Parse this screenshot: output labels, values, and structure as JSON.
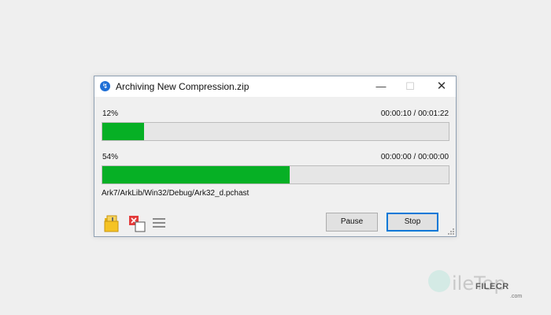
{
  "window": {
    "title": "Archiving New Compression.zip",
    "app_icon": "archive-app-icon",
    "controls": {
      "minimize": "—",
      "maximize": "☐",
      "close": "✕"
    }
  },
  "progress": [
    {
      "percent_label": "12%",
      "percent": 12,
      "time": "00:00:10 / 00:01:22"
    },
    {
      "percent_label": "54%",
      "percent": 54,
      "time": "00:00:00 / 00:00:00"
    }
  ],
  "current_file": "Ark7/ArkLib/Win32/Debug/Ark32_d.pchast",
  "toolbar": {
    "icons": [
      "open-folder-icon",
      "close-window-icon",
      "menu-icon"
    ]
  },
  "buttons": {
    "pause": "Pause",
    "stop": "Stop"
  },
  "colors": {
    "progress_fill": "#06b025",
    "accent": "#0078d7"
  },
  "watermark": {
    "brand": "ileTop",
    "small": "FILECR",
    "dotcom": ".com"
  }
}
